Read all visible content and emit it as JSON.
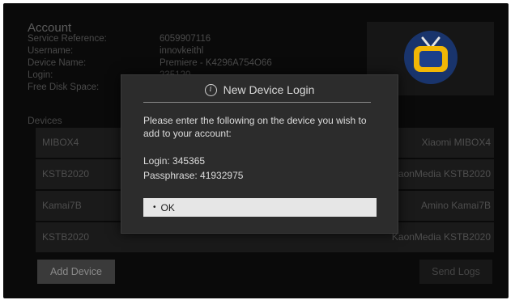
{
  "account": {
    "title": "Account",
    "rows": [
      {
        "label": "Service Reference:",
        "value": "6059907116"
      },
      {
        "label": "Username:",
        "value": "innovkeithl"
      },
      {
        "label": "Device Name:",
        "value": "Premiere - K4296A754O66"
      },
      {
        "label": "Login:",
        "value": "235120"
      },
      {
        "label": "Free Disk Space:",
        "value": ""
      }
    ]
  },
  "devices": {
    "label": "Devices",
    "rows": [
      {
        "left": "MIBOX4",
        "right": "Xiaomi MIBOX4"
      },
      {
        "left": "KSTB2020",
        "right": "KaonMedia KSTB2020"
      },
      {
        "left": "Kamai7B",
        "right": "Amino Kamai7B"
      },
      {
        "left": "KSTB2020",
        "right": "KaonMedia KSTB2020"
      }
    ]
  },
  "buttons": {
    "add_device": "Add Device",
    "send_logs": "Send Logs"
  },
  "modal": {
    "title": "New Device Login",
    "message": "Please enter the following on the device you wish to add to your account:",
    "login_line": "Login: 345365",
    "passphrase_line": "Passphrase: 41932975",
    "ok_label": "OK"
  },
  "colors": {
    "background": "#0a0a0a",
    "modal_bg": "#2c2c2c",
    "ok_bg": "#e6e6e6",
    "logo_yellow": "#f2b705",
    "logo_blue": "#1b3f8a"
  }
}
